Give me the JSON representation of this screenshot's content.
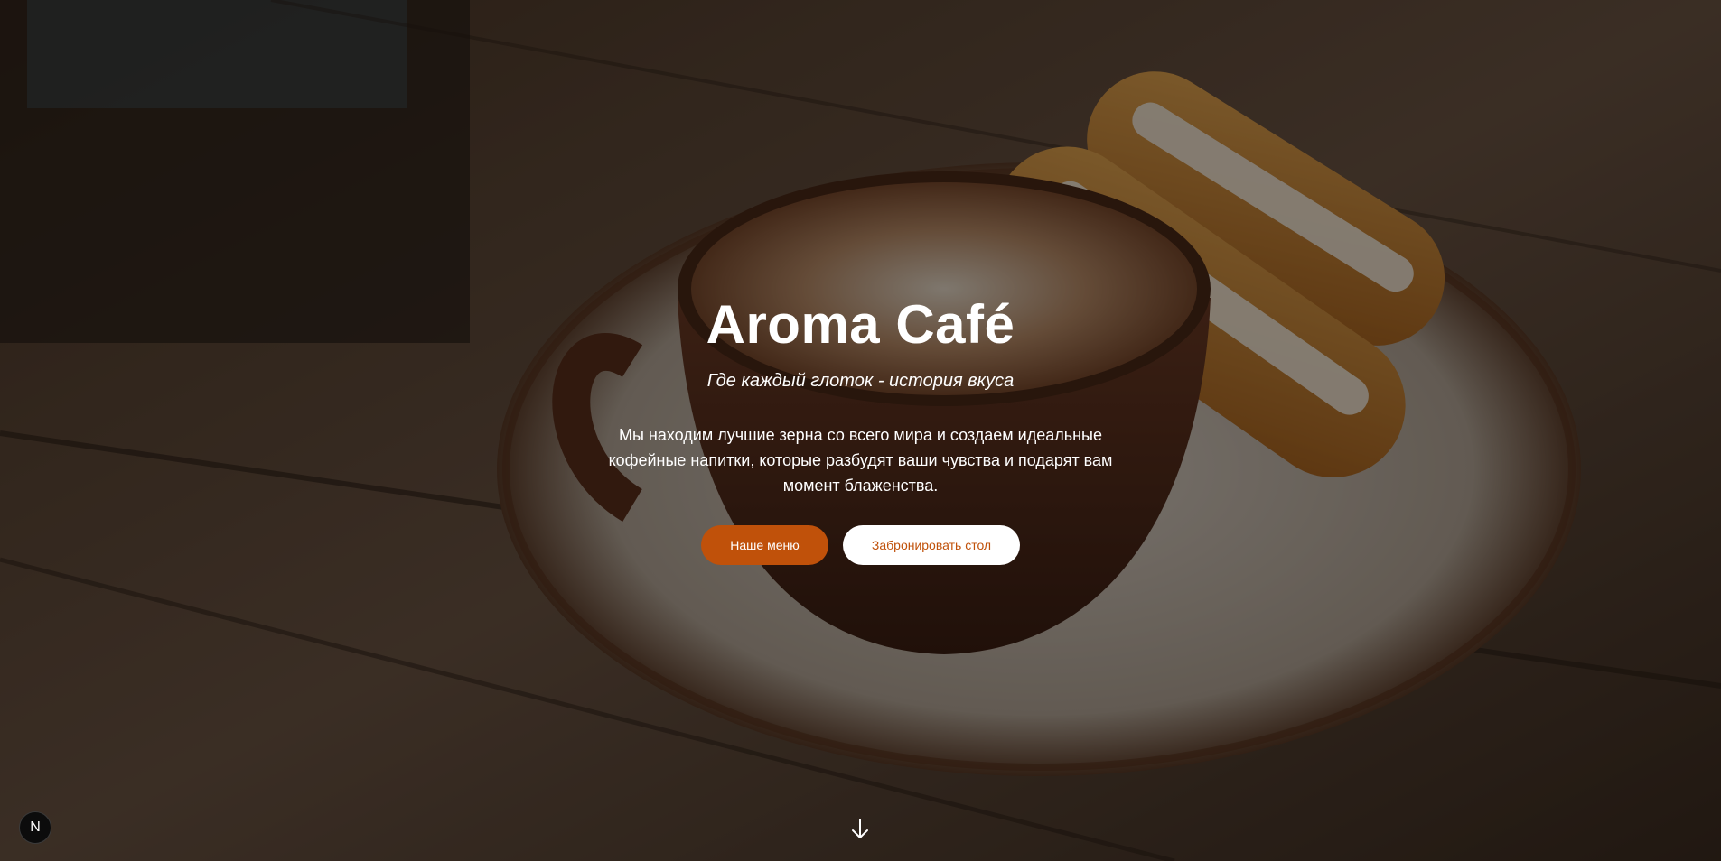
{
  "hero": {
    "title": "Aroma Café",
    "subtitle": "Где каждый глоток - история вкуса",
    "description": "Мы находим лучшие зерна со всего мира и создаем идеальные кофейные напитки, которые разбудят ваши чувства и подарят вам момент блаженства.",
    "menu_button_label": "Наше меню",
    "reserve_button_label": "Забронировать стол",
    "scroll_icon": "arrow-down-icon"
  },
  "badge": {
    "label": "N"
  },
  "colors": {
    "accent": "#c0510a",
    "text": "#ffffff",
    "button_secondary_bg": "#ffffff"
  }
}
